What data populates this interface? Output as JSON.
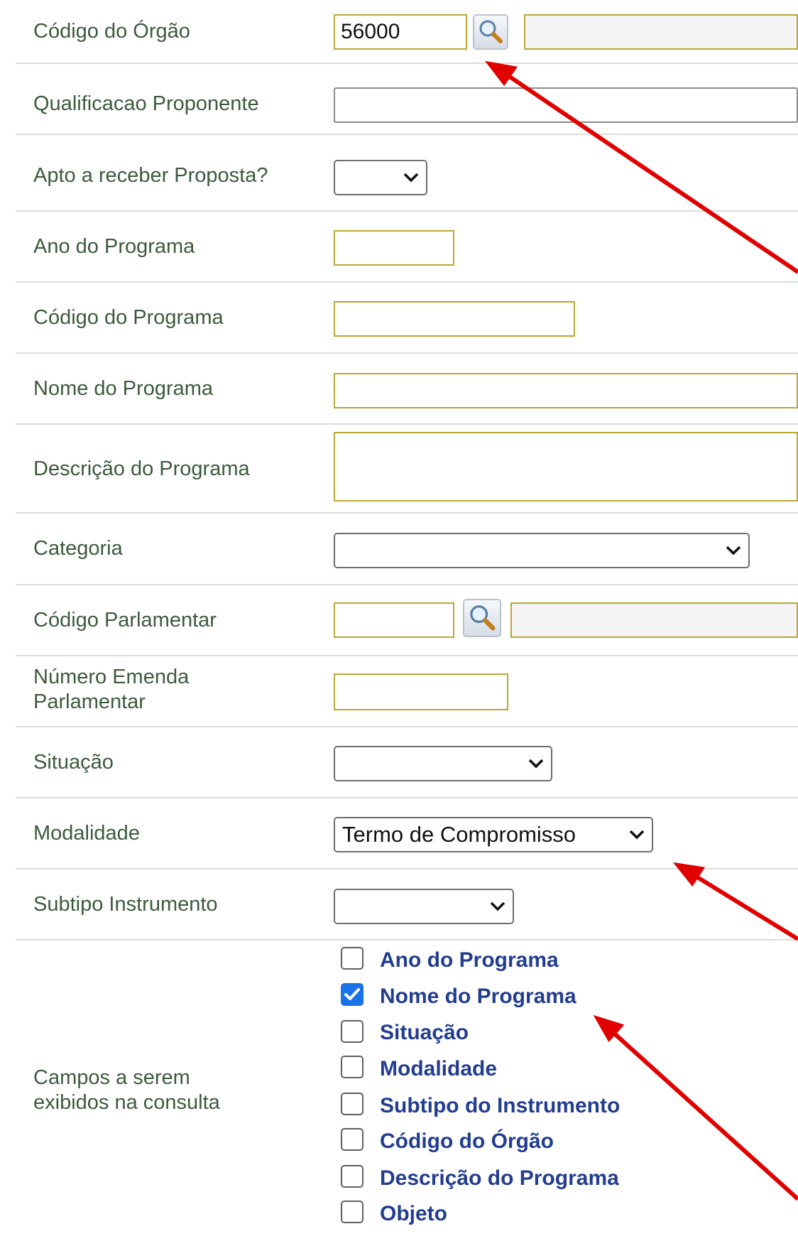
{
  "form": {
    "orgao": {
      "label": "Código do Órgão",
      "value": "56000",
      "name_value": ""
    },
    "qualificacao": {
      "label": "Qualificacao Proponente",
      "value": ""
    },
    "apto": {
      "label": "Apto a receber Proposta?",
      "value": ""
    },
    "ano": {
      "label": "Ano do Programa",
      "value": ""
    },
    "codigo_programa": {
      "label": "Código do Programa",
      "value": ""
    },
    "nome_programa": {
      "label": "Nome do Programa",
      "value": ""
    },
    "descricao_programa": {
      "label": "Descrição do Programa",
      "value": ""
    },
    "categoria": {
      "label": "Categoria",
      "value": ""
    },
    "parlamentar": {
      "label": "Código Parlamentar",
      "value": "",
      "name_value": ""
    },
    "emenda": {
      "label": "Número Emenda Parlamentar",
      "value": ""
    },
    "situacao": {
      "label": "Situação",
      "value": ""
    },
    "modalidade": {
      "label": "Modalidade",
      "value": "Termo de Compromisso"
    },
    "subtipo": {
      "label": "Subtipo Instrumento",
      "value": ""
    },
    "campos": {
      "label": "Campos a serem exibidos na consulta",
      "options": [
        {
          "label": "Ano do Programa",
          "checked": false
        },
        {
          "label": "Nome do Programa",
          "checked": true
        },
        {
          "label": "Situação",
          "checked": false
        },
        {
          "label": "Modalidade",
          "checked": false
        },
        {
          "label": "Subtipo do Instrumento",
          "checked": false
        },
        {
          "label": "Código do Órgão",
          "checked": false
        },
        {
          "label": "Descrição do Programa",
          "checked": false
        },
        {
          "label": "Objeto",
          "checked": false
        }
      ]
    }
  },
  "icons": {
    "lookup": "magnifier-icon",
    "dropdown": "chevron-down-icon",
    "check": "checkmark-icon"
  },
  "colors": {
    "label": "#3c5a3c",
    "field_border": "#b8a832",
    "checkbox_label": "#233d8f",
    "checked": "#1a73e8",
    "annotation_arrow": "#e00000"
  }
}
